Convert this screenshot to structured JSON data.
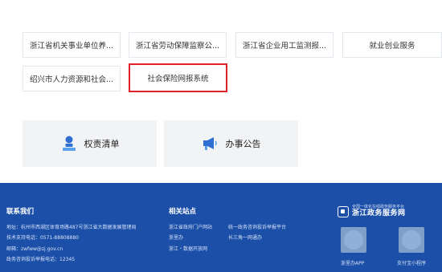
{
  "systems": [
    {
      "label": "浙江省机关事业单位养..."
    },
    {
      "label": "浙江省劳动保障监察公..."
    },
    {
      "label": "浙江省企业用工监测报..."
    },
    {
      "label": "就业创业服务"
    },
    {
      "label": "绍兴市人力资源和社会..."
    },
    {
      "label": "社会保险网报系统"
    }
  ],
  "services": [
    {
      "label": "权责清单",
      "icon": "person-list-icon"
    },
    {
      "label": "办事公告",
      "icon": "megaphone-icon"
    }
  ],
  "footer": {
    "contact": {
      "title": "联系我们",
      "address": "地址：杭州市西湖区体育场路487号浙江省大数据发展管理局",
      "support": "技术支持电话：0571-88808880",
      "email": "邮箱：zwfww@zj.gov.cn",
      "complaint": "政务咨询投诉举报电话：12345"
    },
    "links": {
      "title": "相关站点",
      "items": [
        "浙江省政府门户网站",
        "统一政务咨询投诉举报平台",
        "浙里办",
        "长三角一网通办",
        "浙江・数据开放网"
      ]
    },
    "brand": {
      "subtitle": "全国一体化在线政务服务平台",
      "name": "浙江政务服务网"
    },
    "qr": [
      {
        "caption": "浙里办APP"
      },
      {
        "caption": "支付宝小程序"
      }
    ]
  },
  "colors": {
    "footer_bg": "#1b4fa8",
    "highlight": "#e0202a"
  }
}
